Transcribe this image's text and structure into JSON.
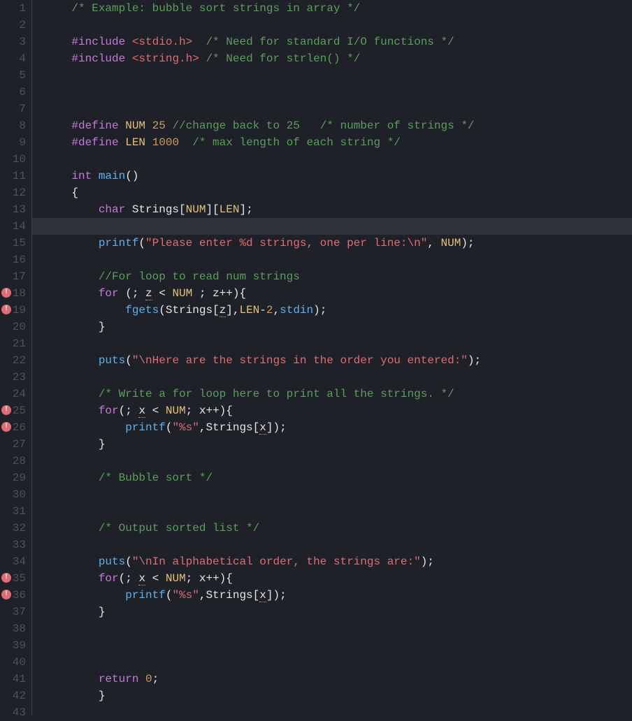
{
  "editor": {
    "current_line": 14,
    "error_lines": [
      18,
      19,
      25,
      26,
      35,
      36
    ],
    "lines": [
      {
        "n": 1,
        "tokens": [
          {
            "t": "",
            "c": "c-white",
            "pad": 4
          },
          {
            "t": "/* Example: bubble sort strings in array */",
            "c": "c-comment"
          }
        ]
      },
      {
        "n": 2,
        "tokens": []
      },
      {
        "n": 3,
        "tokens": [
          {
            "t": "",
            "c": "",
            "pad": 4
          },
          {
            "t": "#include ",
            "c": "c-preproc"
          },
          {
            "t": "<stdio.h>",
            "c": "c-header"
          },
          {
            "t": "  ",
            "c": "c-text"
          },
          {
            "t": "/* Need for standard I/O functions */",
            "c": "c-comment"
          }
        ]
      },
      {
        "n": 4,
        "tokens": [
          {
            "t": "",
            "c": "",
            "pad": 4
          },
          {
            "t": "#include ",
            "c": "c-preproc"
          },
          {
            "t": "<string.h>",
            "c": "c-header"
          },
          {
            "t": " ",
            "c": "c-text"
          },
          {
            "t": "/* Need for strlen() */",
            "c": "c-comment"
          }
        ]
      },
      {
        "n": 5,
        "tokens": []
      },
      {
        "n": 6,
        "tokens": []
      },
      {
        "n": 7,
        "tokens": []
      },
      {
        "n": 8,
        "tokens": [
          {
            "t": "",
            "c": "",
            "pad": 4
          },
          {
            "t": "#define ",
            "c": "c-preproc"
          },
          {
            "t": "NUM",
            "c": "c-ident"
          },
          {
            "t": " ",
            "c": "c-text"
          },
          {
            "t": "25",
            "c": "c-num"
          },
          {
            "t": " ",
            "c": "c-text"
          },
          {
            "t": "//change back to 25   /* number of strings */",
            "c": "c-comment"
          }
        ]
      },
      {
        "n": 9,
        "tokens": [
          {
            "t": "",
            "c": "",
            "pad": 4
          },
          {
            "t": "#define ",
            "c": "c-preproc"
          },
          {
            "t": "LEN",
            "c": "c-ident"
          },
          {
            "t": " ",
            "c": "c-text"
          },
          {
            "t": "1000",
            "c": "c-num"
          },
          {
            "t": "  ",
            "c": "c-text"
          },
          {
            "t": "/* max length of each string */",
            "c": "c-comment"
          }
        ]
      },
      {
        "n": 10,
        "tokens": []
      },
      {
        "n": 11,
        "tokens": [
          {
            "t": "",
            "c": "",
            "pad": 4
          },
          {
            "t": "int",
            "c": "c-type"
          },
          {
            "t": " ",
            "c": "c-text"
          },
          {
            "t": "main",
            "c": "c-func"
          },
          {
            "t": "()",
            "c": "c-white"
          }
        ]
      },
      {
        "n": 12,
        "tokens": [
          {
            "t": "",
            "c": "",
            "pad": 4
          },
          {
            "t": "{",
            "c": "c-white"
          }
        ]
      },
      {
        "n": 13,
        "tokens": [
          {
            "t": "",
            "c": "",
            "pad": 8
          },
          {
            "t": "char",
            "c": "c-type"
          },
          {
            "t": " Strings[",
            "c": "c-white"
          },
          {
            "t": "NUM",
            "c": "c-ident"
          },
          {
            "t": "][",
            "c": "c-white"
          },
          {
            "t": "LEN",
            "c": "c-ident"
          },
          {
            "t": "];",
            "c": "c-white"
          }
        ]
      },
      {
        "n": 14,
        "tokens": []
      },
      {
        "n": 15,
        "tokens": [
          {
            "t": "",
            "c": "",
            "pad": 8
          },
          {
            "t": "printf",
            "c": "c-func"
          },
          {
            "t": "(",
            "c": "c-white"
          },
          {
            "t": "\"Please enter %d strings, one per line:\\n\"",
            "c": "c-string"
          },
          {
            "t": ", ",
            "c": "c-white"
          },
          {
            "t": "NUM",
            "c": "c-ident"
          },
          {
            "t": ");",
            "c": "c-white"
          }
        ]
      },
      {
        "n": 16,
        "tokens": []
      },
      {
        "n": 17,
        "tokens": [
          {
            "t": "",
            "c": "",
            "pad": 8
          },
          {
            "t": "//For loop to read num strings",
            "c": "c-comment"
          }
        ]
      },
      {
        "n": 18,
        "tokens": [
          {
            "t": "",
            "c": "",
            "pad": 8
          },
          {
            "t": "for",
            "c": "c-keyword"
          },
          {
            "t": " (; ",
            "c": "c-white"
          },
          {
            "t": "z",
            "c": "c-white c-warn"
          },
          {
            "t": " < ",
            "c": "c-white"
          },
          {
            "t": "NUM",
            "c": "c-ident"
          },
          {
            "t": " ; z++){",
            "c": "c-white"
          }
        ]
      },
      {
        "n": 19,
        "tokens": [
          {
            "t": "",
            "c": "",
            "pad": 12
          },
          {
            "t": "fgets",
            "c": "c-func"
          },
          {
            "t": "(Strings[",
            "c": "c-white"
          },
          {
            "t": "z",
            "c": "c-white c-warn"
          },
          {
            "t": "],",
            "c": "c-white"
          },
          {
            "t": "LEN",
            "c": "c-ident"
          },
          {
            "t": "-",
            "c": "c-white"
          },
          {
            "t": "2",
            "c": "c-num"
          },
          {
            "t": ",",
            "c": "c-white"
          },
          {
            "t": "stdin",
            "c": "c-func"
          },
          {
            "t": ");",
            "c": "c-white"
          }
        ]
      },
      {
        "n": 20,
        "tokens": [
          {
            "t": "",
            "c": "",
            "pad": 8
          },
          {
            "t": "}",
            "c": "c-white"
          }
        ]
      },
      {
        "n": 21,
        "tokens": []
      },
      {
        "n": 22,
        "tokens": [
          {
            "t": "",
            "c": "",
            "pad": 8
          },
          {
            "t": "puts",
            "c": "c-func"
          },
          {
            "t": "(",
            "c": "c-white"
          },
          {
            "t": "\"\\nHere are the strings in the order you entered:\"",
            "c": "c-string"
          },
          {
            "t": ");",
            "c": "c-white"
          }
        ]
      },
      {
        "n": 23,
        "tokens": []
      },
      {
        "n": 24,
        "tokens": [
          {
            "t": "",
            "c": "",
            "pad": 8
          },
          {
            "t": "/* Write a for loop here to print all the strings. */",
            "c": "c-comment"
          }
        ]
      },
      {
        "n": 25,
        "tokens": [
          {
            "t": "",
            "c": "",
            "pad": 8
          },
          {
            "t": "for",
            "c": "c-keyword"
          },
          {
            "t": "(; ",
            "c": "c-white"
          },
          {
            "t": "x",
            "c": "c-white c-warn"
          },
          {
            "t": " < ",
            "c": "c-white"
          },
          {
            "t": "NUM",
            "c": "c-ident"
          },
          {
            "t": "; x++){",
            "c": "c-white"
          }
        ]
      },
      {
        "n": 26,
        "tokens": [
          {
            "t": "",
            "c": "",
            "pad": 12
          },
          {
            "t": "printf",
            "c": "c-func"
          },
          {
            "t": "(",
            "c": "c-white"
          },
          {
            "t": "\"%s\"",
            "c": "c-string"
          },
          {
            "t": ",Strings[",
            "c": "c-white"
          },
          {
            "t": "x",
            "c": "c-white c-warn"
          },
          {
            "t": "]);",
            "c": "c-white"
          }
        ]
      },
      {
        "n": 27,
        "tokens": [
          {
            "t": "",
            "c": "",
            "pad": 8
          },
          {
            "t": "}",
            "c": "c-white"
          }
        ]
      },
      {
        "n": 28,
        "tokens": []
      },
      {
        "n": 29,
        "tokens": [
          {
            "t": "",
            "c": "",
            "pad": 8
          },
          {
            "t": "/* Bubble sort */",
            "c": "c-comment"
          }
        ]
      },
      {
        "n": 30,
        "tokens": []
      },
      {
        "n": 31,
        "tokens": []
      },
      {
        "n": 32,
        "tokens": [
          {
            "t": "",
            "c": "",
            "pad": 8
          },
          {
            "t": "/* Output sorted list */",
            "c": "c-comment"
          }
        ]
      },
      {
        "n": 33,
        "tokens": []
      },
      {
        "n": 34,
        "tokens": [
          {
            "t": "",
            "c": "",
            "pad": 8
          },
          {
            "t": "puts",
            "c": "c-func"
          },
          {
            "t": "(",
            "c": "c-white"
          },
          {
            "t": "\"\\nIn alphabetical order, the strings are:\"",
            "c": "c-string"
          },
          {
            "t": ");",
            "c": "c-white"
          }
        ]
      },
      {
        "n": 35,
        "tokens": [
          {
            "t": "",
            "c": "",
            "pad": 8
          },
          {
            "t": "for",
            "c": "c-keyword"
          },
          {
            "t": "(; ",
            "c": "c-white"
          },
          {
            "t": "x",
            "c": "c-white c-warn"
          },
          {
            "t": " < ",
            "c": "c-white"
          },
          {
            "t": "NUM",
            "c": "c-ident"
          },
          {
            "t": "; x++){",
            "c": "c-white"
          }
        ]
      },
      {
        "n": 36,
        "tokens": [
          {
            "t": "",
            "c": "",
            "pad": 12
          },
          {
            "t": "printf",
            "c": "c-func"
          },
          {
            "t": "(",
            "c": "c-white"
          },
          {
            "t": "\"%s\"",
            "c": "c-string"
          },
          {
            "t": ",Strings[",
            "c": "c-white"
          },
          {
            "t": "x",
            "c": "c-white c-warn"
          },
          {
            "t": "]);",
            "c": "c-white"
          }
        ]
      },
      {
        "n": 37,
        "tokens": [
          {
            "t": "",
            "c": "",
            "pad": 8
          },
          {
            "t": "}",
            "c": "c-white"
          }
        ]
      },
      {
        "n": 38,
        "tokens": []
      },
      {
        "n": 39,
        "tokens": []
      },
      {
        "n": 40,
        "tokens": []
      },
      {
        "n": 41,
        "tokens": [
          {
            "t": "",
            "c": "",
            "pad": 8
          },
          {
            "t": "return",
            "c": "c-keyword"
          },
          {
            "t": " ",
            "c": "c-white"
          },
          {
            "t": "0",
            "c": "c-num"
          },
          {
            "t": ";",
            "c": "c-white"
          }
        ]
      },
      {
        "n": 42,
        "tokens": [
          {
            "t": "",
            "c": "",
            "pad": 8
          },
          {
            "t": "}",
            "c": "c-white"
          }
        ]
      },
      {
        "n": 43,
        "tokens": []
      }
    ]
  }
}
